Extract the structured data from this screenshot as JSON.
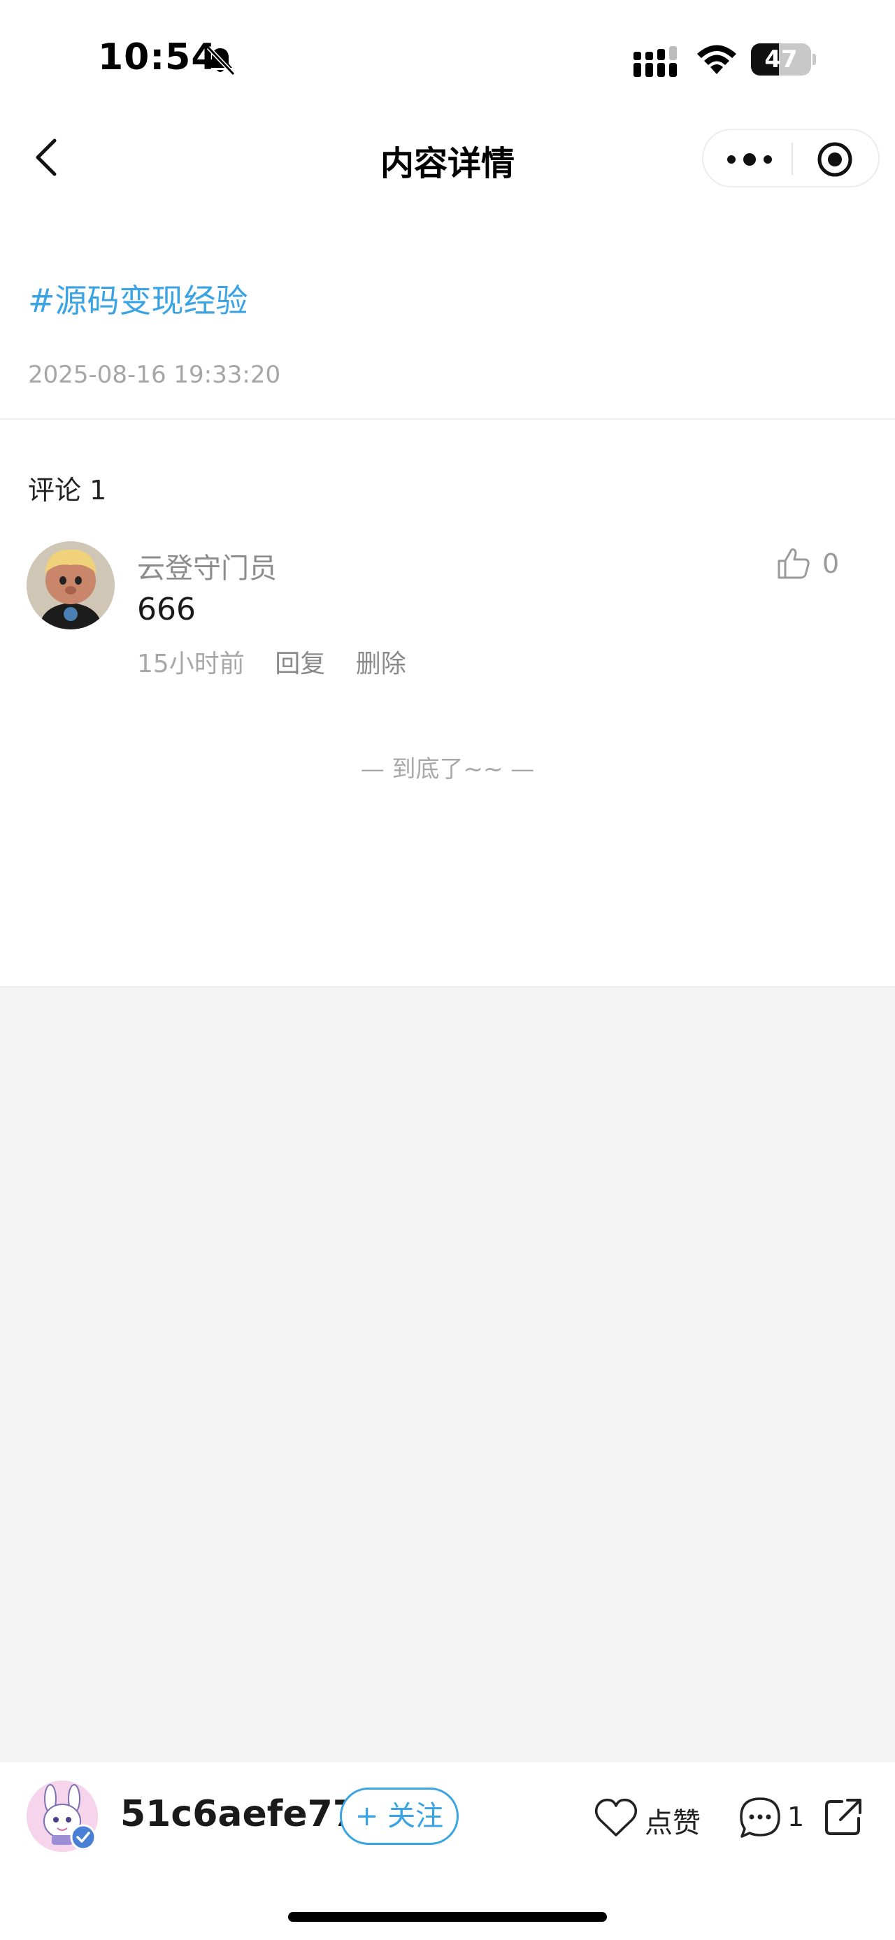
{
  "status_bar": {
    "time": "10:54",
    "battery_level": "47",
    "battery_fraction": 0.47
  },
  "nav": {
    "title": "内容详情"
  },
  "post": {
    "topic": "#源码变现经验",
    "timestamp": "2025-08-16 19:33:20"
  },
  "comments": {
    "heading": "评论 1",
    "items": [
      {
        "author": "云登守门员",
        "text": "666",
        "time": "15小时前",
        "reply_label": "回复",
        "delete_label": "删除",
        "likes": "0"
      }
    ],
    "end_text": "— 到底了~~ —"
  },
  "bottom_bar": {
    "username": "51c6aefe77",
    "follow_label": "+ 关注",
    "like_label": "点赞",
    "comment_count": "1"
  },
  "colors": {
    "accent": "#3aa3e3",
    "muted_text": "#a6a6a6",
    "background_gray": "#f4f4f4"
  },
  "icons": [
    "bell-mute-icon",
    "signal-icon",
    "wifi-icon",
    "battery-icon",
    "back-icon",
    "more-icon",
    "close-target-icon",
    "thumb-up-icon",
    "heart-icon",
    "comment-bubble-icon",
    "share-icon",
    "verified-badge-icon"
  ]
}
